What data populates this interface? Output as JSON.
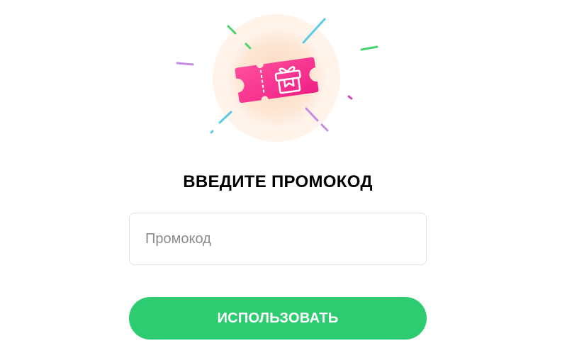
{
  "promo": {
    "title": "ВВЕДИТЕ ПРОМОКОД",
    "input_placeholder": "Промокод",
    "input_value": "",
    "submit_label": "ИСПОЛЬЗОВАТЬ"
  },
  "illustration": {
    "icon": "gift-ticket-icon",
    "colors": {
      "ticket_gradient_start": "#ff2e93",
      "ticket_gradient_end": "#ff6aa8",
      "glow": "#fde4cf",
      "accent_green": "#2ecc71",
      "confetti_green": "#49d36f",
      "confetti_blue": "#5ccbe9",
      "confetti_purple": "#c28be6",
      "confetti_magenta": "#d04ab8"
    }
  },
  "theme": {
    "button_color": "#2ecc71",
    "button_text_color": "#ffffff",
    "input_border": "#e2e2e2"
  }
}
